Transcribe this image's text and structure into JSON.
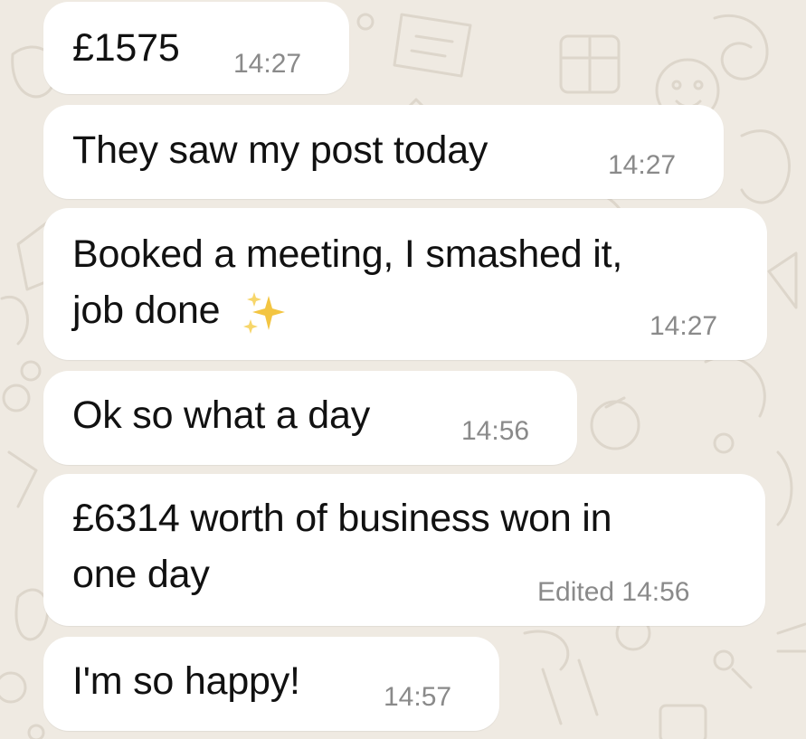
{
  "messages": [
    {
      "text": "£1575",
      "time": "14:27"
    },
    {
      "text": "They saw my post today",
      "time": "14:27"
    },
    {
      "line1": "Booked a meeting, I smashed it,",
      "line2": "job done",
      "emoji": "sparkles-emoji",
      "time": "14:27"
    },
    {
      "text": "Ok so what a day",
      "time": "14:56"
    },
    {
      "line1": "£6314 worth of business won in",
      "line2": "one day",
      "edited": "Edited",
      "time": "14:56"
    },
    {
      "text": "I'm so happy!",
      "time": "14:57"
    }
  ],
  "colors": {
    "wallpaper": "#efeae2",
    "bubble": "#ffffff",
    "text": "#111111",
    "timestamp": "#8a8a8a",
    "sparkle": "#f3c542"
  }
}
